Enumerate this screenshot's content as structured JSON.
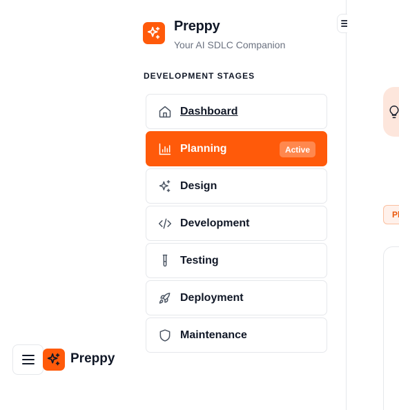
{
  "brand": {
    "name": "Preppy",
    "tagline": "Your AI SDLC Companion",
    "accent": "#ff5a0a"
  },
  "section_heading": "DEVELOPMENT STAGES",
  "nav": [
    {
      "label": "Dashboard",
      "icon": "home-icon"
    },
    {
      "label": "Planning",
      "icon": "bar-chart-icon",
      "active": true,
      "badge": "Active"
    },
    {
      "label": "Design",
      "icon": "sparkles-icon"
    },
    {
      "label": "Development",
      "icon": "code-icon"
    },
    {
      "label": "Testing",
      "icon": "test-tube-icon"
    },
    {
      "label": "Deployment",
      "icon": "rocket-icon"
    },
    {
      "label": "Maintenance",
      "icon": "shield-icon"
    }
  ],
  "mobile_header": {
    "title": "Preppy"
  },
  "main": {
    "chip_text": "Pl"
  }
}
